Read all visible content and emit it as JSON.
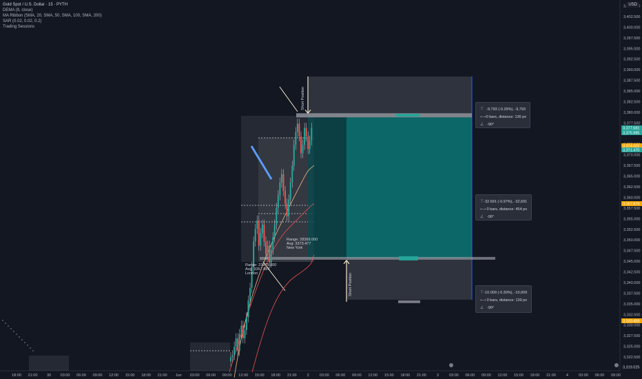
{
  "chart_data": {
    "type": "candlestick",
    "symbol_title": "Gold Spot / U.S. Dollar · 15 · PYTH",
    "indicators": [
      "DEMA (9, close)",
      "MA Ribbon (SMA, 20, SMA, 50, SMA, 100, SMA, 200)",
      "SAR (0.02, 0.02, 0.2)",
      "Trading Sessions"
    ],
    "currency": "USD",
    "y_ticks": [
      "3,405.000",
      "3,402.500",
      "3,400.000",
      "3,397.500",
      "3,395.000",
      "3,392.500",
      "3,390.000",
      "3,387.500",
      "3,385.000",
      "3,382.500",
      "3,380.000",
      "3,377.500",
      "3,375.000",
      "3,372.500",
      "3,370.000",
      "3,367.500",
      "3,365.000",
      "3,362.500",
      "3,360.000",
      "3,357.500",
      "3,355.000",
      "3,352.500",
      "3,350.000",
      "3,347.500",
      "3,345.000",
      "3,342.500",
      "3,340.000",
      "3,337.500",
      "3,335.000",
      "3,332.500",
      "3,330.000",
      "3,327.500",
      "3,325.000",
      "3,322.500",
      "3,319.025"
    ],
    "ylim": [
      3319.025,
      3405.0
    ],
    "x_ticks": [
      "18:00",
      "21:00",
      "30",
      "03:00",
      "06:00",
      "09:00",
      "12:00",
      "15:00",
      "18:00",
      "21:00",
      "Jun",
      "03:00",
      "06:00",
      "09:00",
      "12:00",
      "15:00",
      "18:00",
      "21:00",
      "2",
      "03:00",
      "06:00",
      "09:00",
      "12:00",
      "15:00",
      "18:00",
      "21:00",
      "3",
      "03:00",
      "06:00",
      "09:00",
      "12:00",
      "15:00",
      "18:00",
      "21:00",
      "4",
      "03:00",
      "06:00",
      "09:00"
    ],
    "price_labels": [
      {
        "text": "3,377.681",
        "color": "#26a69a"
      },
      {
        "text": "3,375.985",
        "color": "#26a69a"
      },
      {
        "text": "3,374.002",
        "color": "#f7a600"
      },
      {
        "text": "3,371.470",
        "color": "#26a69a"
      },
      {
        "text": "3,357.879",
        "color": "#f7a600"
      },
      {
        "text": "3,330.459",
        "color": "#f7a600"
      },
      {
        "text": "3,319.025",
        "color": "#131722"
      }
    ],
    "candles_close": [
      3321.5,
      3322,
      3324,
      3326,
      3323,
      3327,
      3329,
      3326,
      3328,
      3331,
      3335,
      3338,
      3343,
      3349,
      3352,
      3354,
      3348,
      3351,
      3353,
      3349,
      3346,
      3348,
      3344,
      3347,
      3350,
      3353,
      3357,
      3360,
      3363,
      3365,
      3361,
      3358,
      3355,
      3359,
      3363,
      3367,
      3372,
      3375,
      3377,
      3374,
      3370,
      3372,
      3376,
      3374,
      3371,
      3373,
      3376
    ],
    "sessions": [
      {
        "label": "Range: 23975.000",
        "avg": "Avg: 3357.889",
        "name": "London"
      },
      {
        "label": "Range: 28369.000",
        "avg": "Avg: 3373.477",
        "name": "New York"
      }
    ],
    "position": {
      "entry": 3377.681,
      "stop": 3379.8,
      "target": 3345.0,
      "label_top": "Short Position",
      "label_bottom": "Short Position"
    },
    "measures": [
      {
        "line1": "-9.793 (-0.29%), -9,793",
        "line2": "0 bars, distance: 136 px",
        "line3": "-90°"
      },
      {
        "line1": "-32.691 (-0.97%), -32,691",
        "line2": "0 bars, distance: 454 px",
        "line3": "-90°"
      },
      {
        "line1": "-10.009 (-0.30%), -10,009",
        "line2": "0 bars, distance: 139 px",
        "line3": "-90°"
      }
    ],
    "colors": {
      "up": "#26a69a",
      "down": "#ef5350",
      "background": "#131722",
      "target_zone": "#0d6e6e",
      "stop_zone": "#3a3d47"
    }
  }
}
